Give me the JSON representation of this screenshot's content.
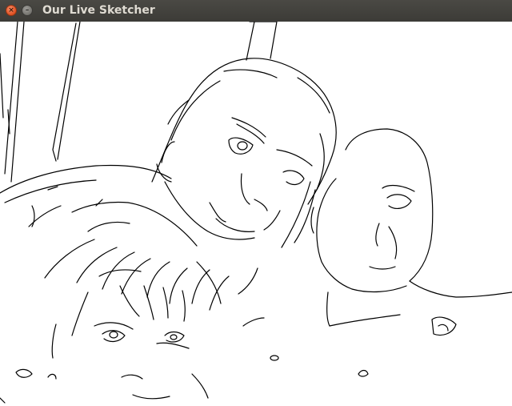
{
  "window": {
    "title": "Our Live Sketcher",
    "close_glyph": "×",
    "minimize_glyph": "–"
  },
  "canvas": {
    "content": "edge-detected-webcam-sketch"
  }
}
